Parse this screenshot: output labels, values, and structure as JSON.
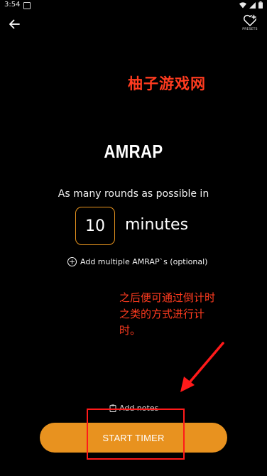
{
  "status_bar": {
    "time": "3:54",
    "icons": [
      "app-notification-icon",
      "wifi-icon",
      "signal-icon",
      "battery-icon"
    ]
  },
  "app_bar": {
    "back_icon": "arrow-left-icon",
    "presets_icon": "heart-plus-icon",
    "presets_label": "PRESETS"
  },
  "overlay": {
    "watermark": "柚子游戏网",
    "annotation": "之后便可通过倒计时之类的方式进行计时。",
    "color": "#ff3b1f"
  },
  "workout": {
    "title": "AMRAP",
    "subtitle": "As many rounds as possible in",
    "minutes_value": "10",
    "minutes_label": "minutes",
    "add_multiple_label": "Add multiple AMRAP`s (optional)",
    "add_notes_label": "Add notes"
  },
  "actions": {
    "start_label": "START TIMER"
  },
  "colors": {
    "accent": "#e8921f",
    "background": "#000000",
    "annotation_red": "#ff1a1a"
  }
}
